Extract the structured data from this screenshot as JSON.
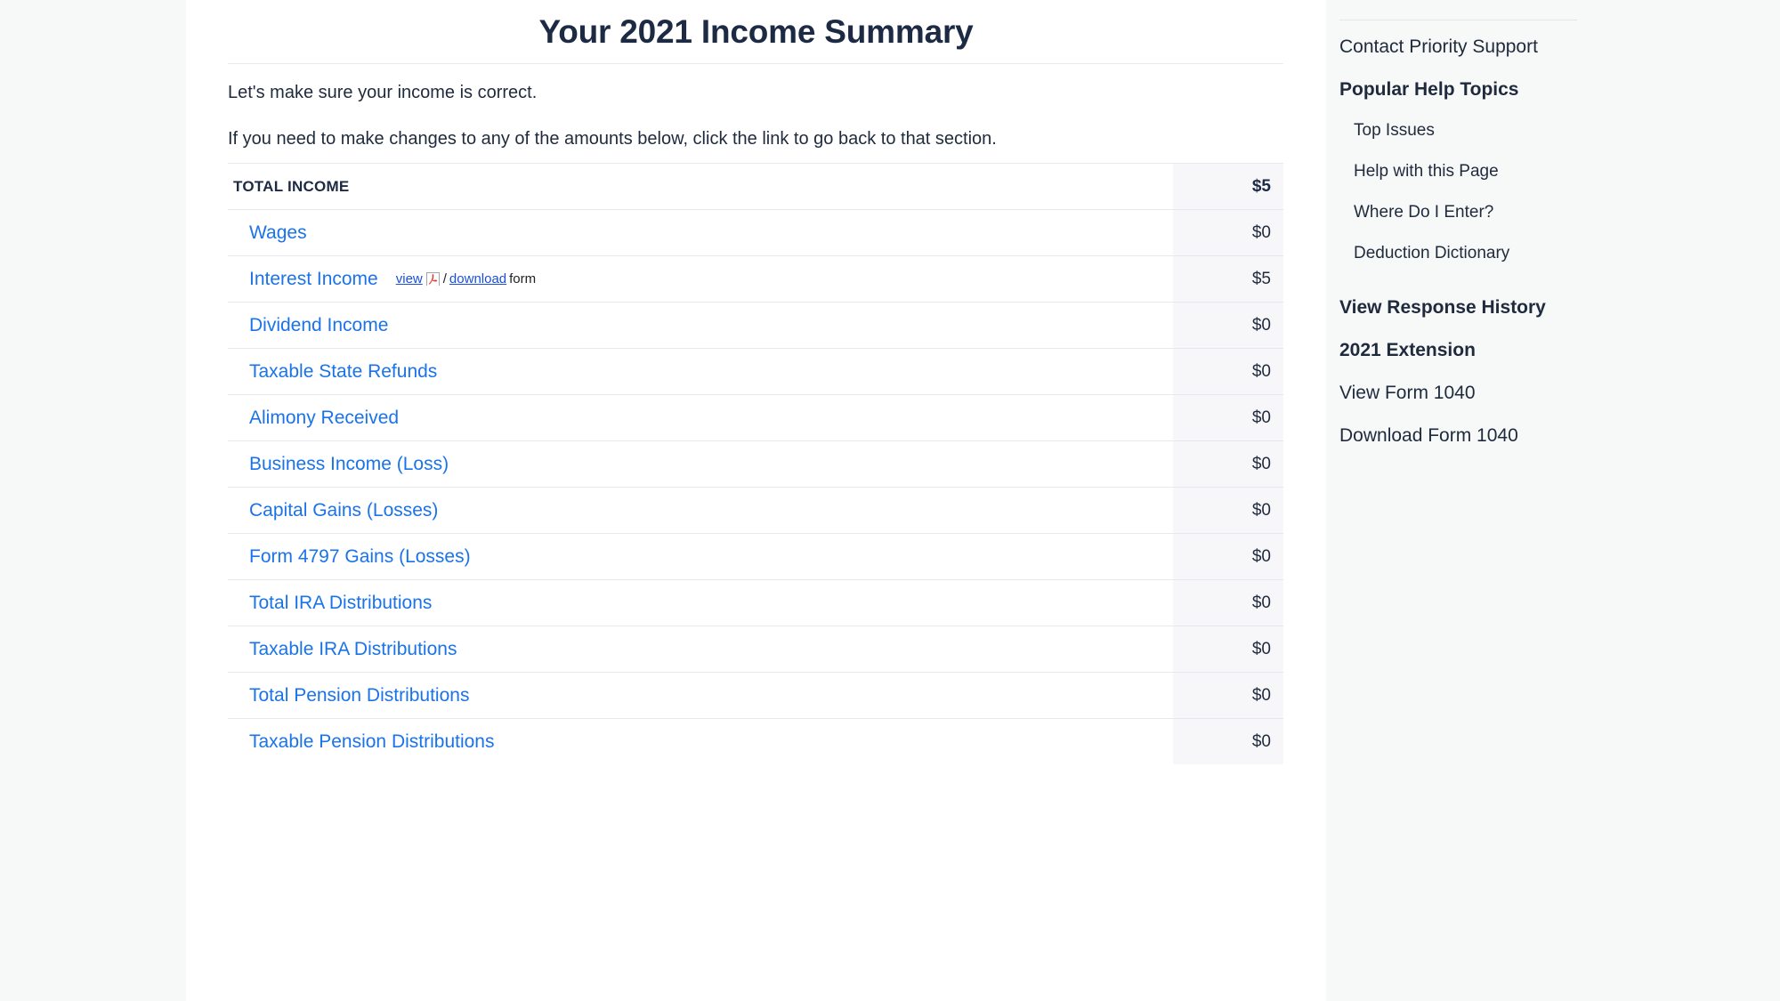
{
  "header": {
    "title": "Your 2021 Income Summary"
  },
  "intro": {
    "line1": "Let's make sure your income is correct.",
    "line2": "If you need to make changes to any of the amounts below, click the link to go back to that section."
  },
  "table": {
    "header": {
      "label": "TOTAL INCOME",
      "amount": "$5"
    },
    "rows": [
      {
        "label": "Wages",
        "amount": "$0"
      },
      {
        "label": "Interest Income",
        "amount": "$5",
        "form_links": {
          "view": "view",
          "icon": "pdf-icon",
          "separator": "/",
          "download": "download",
          "suffix": "form"
        }
      },
      {
        "label": "Dividend Income",
        "amount": "$0"
      },
      {
        "label": "Taxable State Refunds",
        "amount": "$0"
      },
      {
        "label": "Alimony Received",
        "amount": "$0"
      },
      {
        "label": "Business Income (Loss)",
        "amount": "$0"
      },
      {
        "label": "Capital Gains (Losses)",
        "amount": "$0"
      },
      {
        "label": "Form 4797 Gains (Losses)",
        "amount": "$0"
      },
      {
        "label": "Total IRA Distributions",
        "amount": "$0"
      },
      {
        "label": "Taxable IRA Distributions",
        "amount": "$0"
      },
      {
        "label": "Total Pension Distributions",
        "amount": "$0"
      },
      {
        "label": "Taxable Pension Distributions",
        "amount": "$0"
      }
    ]
  },
  "sidebar": {
    "items": [
      {
        "label": "Contact Priority Support",
        "style": "plain"
      },
      {
        "label": "Popular Help Topics",
        "style": "bold"
      },
      {
        "label": "Top Issues",
        "style": "indent"
      },
      {
        "label": "Help with this Page",
        "style": "indent"
      },
      {
        "label": "Where Do I Enter?",
        "style": "indent"
      },
      {
        "label": "Deduction Dictionary",
        "style": "indent"
      },
      {
        "label": "View Response History",
        "style": "bold-gap"
      },
      {
        "label": "2021 Extension",
        "style": "bold"
      },
      {
        "label": "View Form 1040",
        "style": "plain"
      },
      {
        "label": "Download Form 1040",
        "style": "plain"
      }
    ]
  },
  "colors": {
    "link_blue": "#1a73e8",
    "heading_navy": "#1d2a44",
    "amount_column_bg": "#f7f7f9",
    "page_bg": "#f7f8f8",
    "content_bg": "#ffffff",
    "row_border": "#e6e8ed",
    "pdf_red": "#e0352b"
  }
}
